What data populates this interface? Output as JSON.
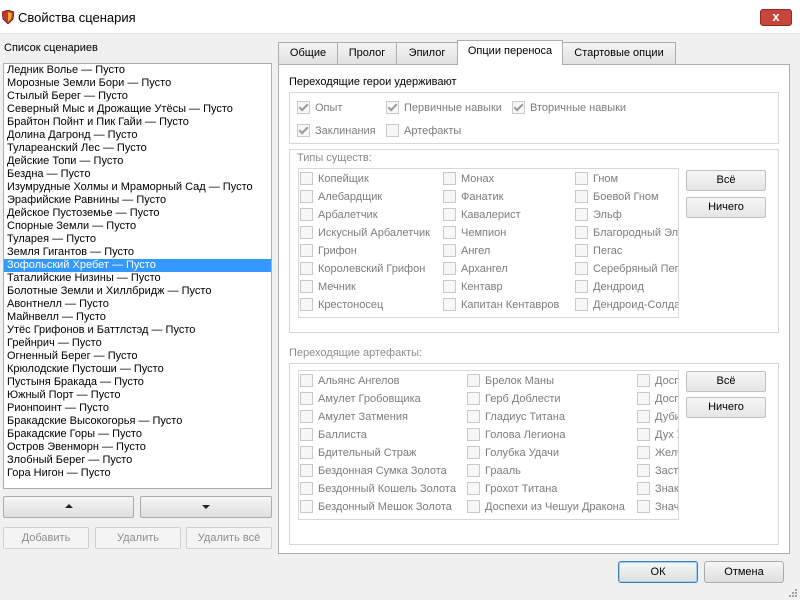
{
  "window": {
    "title": "Свойства сценария",
    "close_label": "x"
  },
  "left": {
    "label": "Список сценариев",
    "items": [
      "Ледник Волье — Пусто",
      "Морозные Земли Бори — Пусто",
      "Стылый Берег — Пусто",
      "Северный Мыс и Дрожащие Утёсы — Пусто",
      "Брайтон Пойнт и Пик Гайи — Пусто",
      "Долина Дагронд — Пусто",
      "Тулареанский Лес — Пусто",
      "Дейские Топи — Пусто",
      "Бездна — Пусто",
      "Изумрудные Холмы и Мраморный Сад — Пусто",
      "Эрафийские Равнины — Пусто",
      "Дейское Пустоземье — Пусто",
      "Спорные Земли — Пусто",
      "Туларея — Пусто",
      "Земля Гигантов — Пусто",
      "Зофольский Хребет — Пусто",
      "Таталийские Низины — Пусто",
      "Болотные Земли и Хиллбридж — Пусто",
      "Авонтнелл — Пусто",
      "Майнвелл — Пусто",
      "Утёс Грифонов и Баттлстэд — Пусто",
      "Грейнрич — Пусто",
      "Огненный Берег — Пусто",
      "Крюлодские Пустоши — Пусто",
      "Пустыня Бракада — Пусто",
      "Южный Порт — Пусто",
      "Рионпоинт — Пусто",
      "Бракадские Высокогорья — Пусто",
      "Бракадские Горы — Пусто",
      "Остров Эвенморн — Пусто",
      "Злобный Берег — Пусто",
      "Гора Нигон — Пусто"
    ],
    "selected_index": 15,
    "add_label": "Добавить",
    "remove_label": "Удалить",
    "remove_all_label": "Удалить всё"
  },
  "tabs": [
    "Общие",
    "Пролог",
    "Эпилог",
    "Опции переноса",
    "Стартовые опции"
  ],
  "active_tab": 3,
  "carry": {
    "heroes_label": "Переходящие герои удерживают",
    "hero_options": [
      {
        "label": "Опыт",
        "checked": true
      },
      {
        "label": "Первичные навыки",
        "checked": true
      },
      {
        "label": "Вторичные навыки",
        "checked": true
      },
      {
        "label": "Заклинания",
        "checked": true
      },
      {
        "label": "Артефакты",
        "checked": false
      }
    ],
    "creatures_label": "Типы существ:",
    "creature_cols": [
      [
        "Копейщик",
        "Алебардщик",
        "Арбалетчик",
        "Искусный Арбалетчик",
        "Грифон",
        "Королевский Грифон",
        "Мечник",
        "Крестоносец"
      ],
      [
        "Монах",
        "Фанатик",
        "Кавалерист",
        "Чемпион",
        "Ангел",
        "Архангел",
        "Кентавр",
        "Капитан Кентавров"
      ],
      [
        "Гном",
        "Боевой Гном",
        "Эльф",
        "Благородный Эльф",
        "Пегас",
        "Серебряный Пегас",
        "Дендроид",
        "Дендроид-Солдат"
      ]
    ],
    "all_label": "Всё",
    "none_label": "Ничего",
    "artifacts_label": "Переходящие артефакты:",
    "artifact_cols": [
      [
        "Альянс Ангелов",
        "Амулет Гробовщика",
        "Амулет Затмения",
        "Баллиста",
        "Бдительный Страж",
        "Бездонная Сумка Золота",
        "Бездонный Кошель Золота",
        "Бездонный Мешок Золота"
      ],
      [
        "Брелок Маны",
        "Герб Доблести",
        "Гладиус Титана",
        "Голова Легиона",
        "Голубка Удачи",
        "Грааль",
        "Грохот Титана",
        "Доспехи из Чешуи Дракона"
      ],
      [
        "Доспехи Проклятого",
        "Доспехи Чудовищ",
        "Дубина Огра",
        "Дух Угнетения",
        "Желчная Стрела",
        "Застёжка Отваги",
        "Знак Ордена",
        "Значок Отваги"
      ]
    ],
    "artifact_all_label": "Всё",
    "artifact_none_label": "Ничего"
  },
  "dialog": {
    "ok_label": "ОК",
    "cancel_label": "Отмена"
  },
  "colors": {
    "selection": "#3399ff",
    "close": "#c7453a",
    "default_border": "#3c7fb1"
  }
}
